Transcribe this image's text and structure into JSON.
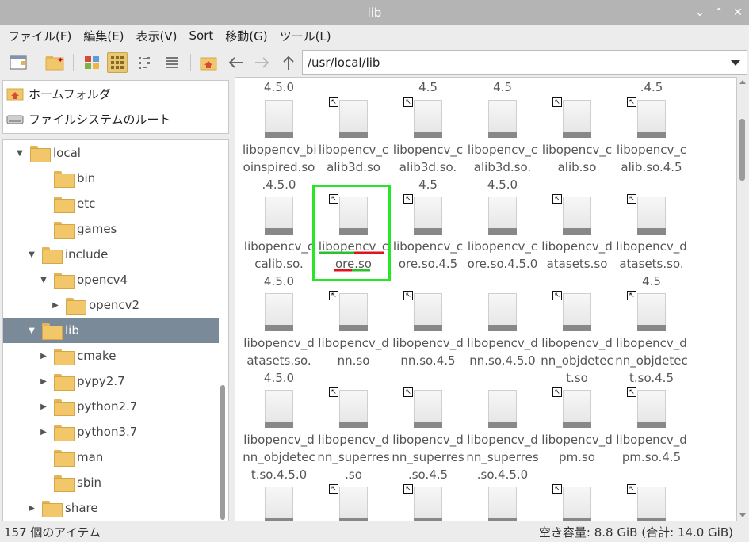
{
  "window": {
    "title": "lib",
    "buttons": [
      "⌄",
      "⌃",
      "✕"
    ]
  },
  "menu": [
    "ファイル(F)",
    "編集(E)",
    "表示(V)",
    "Sort",
    "移動(G)",
    "ツール(L)"
  ],
  "toolbar": {
    "path": "/usr/local/lib"
  },
  "places": [
    {
      "label": "ホームフォルダ",
      "icon": "home-folder-icon"
    },
    {
      "label": "ファイルシステムのルート",
      "icon": "drive-icon"
    }
  ],
  "tree": [
    {
      "label": "local",
      "arrow": "▼"
    },
    {
      "label": "bin",
      "arrow": ""
    },
    {
      "label": "etc",
      "arrow": ""
    },
    {
      "label": "games",
      "arrow": ""
    },
    {
      "label": "include",
      "arrow": "▼"
    },
    {
      "label": "opencv4",
      "arrow": "▼"
    },
    {
      "label": "opencv2",
      "arrow": "▶"
    },
    {
      "label": "lib",
      "arrow": "▼",
      "selected": true
    },
    {
      "label": "cmake",
      "arrow": "▶"
    },
    {
      "label": "pypy2.7",
      "arrow": "▶"
    },
    {
      "label": "python2.7",
      "arrow": "▶"
    },
    {
      "label": "python3.7",
      "arrow": "▶"
    },
    {
      "label": "man",
      "arrow": ""
    },
    {
      "label": "sbin",
      "arrow": ""
    },
    {
      "label": "share",
      "arrow": "▶"
    }
  ],
  "top_fragments": [
    "4.5.0",
    "",
    "4.5",
    "4.5",
    "",
    ".4.5"
  ],
  "files": [
    {
      "name": "libopencv_bi\noinspired.so\n.4.5.0",
      "link": false
    },
    {
      "name": "libopencv_c\nalib3d.so",
      "link": true
    },
    {
      "name": "libopencv_c\nalib3d.so.\n4.5",
      "link": true
    },
    {
      "name": "libopencv_c\nalib3d.so.\n4.5.0",
      "link": false
    },
    {
      "name": "libopencv_c\nalib.so",
      "link": true
    },
    {
      "name": "libopencv_c\nalib.so.4.5",
      "link": true
    },
    {
      "name": "libopencv_c\ncalib.so.\n4.5.0",
      "link": false
    },
    {
      "name": "libopencv_c\nore.so",
      "link": true
    },
    {
      "name": "libopencv_c\nore.so.4.5",
      "link": true
    },
    {
      "name": "libopencv_c\nore.so.4.5.0",
      "link": false
    },
    {
      "name": "libopencv_d\natasets.so",
      "link": true
    },
    {
      "name": "libopencv_d\natasets.so.\n4.5",
      "link": true
    },
    {
      "name": "libopencv_d\natasets.so.\n4.5.0",
      "link": false
    },
    {
      "name": "libopencv_d\nnn.so",
      "link": true
    },
    {
      "name": "libopencv_d\nnn.so.4.5",
      "link": true
    },
    {
      "name": "libopencv_d\nnn.so.4.5.0",
      "link": false
    },
    {
      "name": "libopencv_d\nnn_objdetec\nt.so",
      "link": true
    },
    {
      "name": "libopencv_d\nnn_objdetec\nt.so.4.5",
      "link": true
    },
    {
      "name": "libopencv_d\nnn_objdetec\nt.so.4.5.0",
      "link": false
    },
    {
      "name": "libopencv_d\nnn_superres\n.so",
      "link": true
    },
    {
      "name": "libopencv_d\nnn_superres\n.so.4.5",
      "link": true
    },
    {
      "name": "libopencv_d\nnn_superres\n.so.4.5.0",
      "link": false
    },
    {
      "name": "libopencv_d\npm.so",
      "link": true
    },
    {
      "name": "libopencv_d\npm.so.4.5",
      "link": true
    },
    {
      "name": "",
      "link": false
    },
    {
      "name": "",
      "link": true
    },
    {
      "name": "",
      "link": true
    },
    {
      "name": "",
      "link": false
    },
    {
      "name": "",
      "link": true
    },
    {
      "name": "",
      "link": true
    }
  ],
  "status": {
    "count": "157 個のアイテム",
    "space": "空き容量: 8.8 GiB (合計: 14.0 GiB)"
  }
}
